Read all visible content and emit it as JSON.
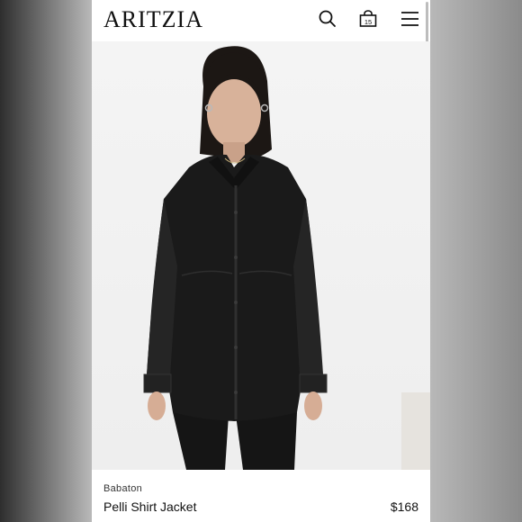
{
  "header": {
    "logo": "ARITZIA",
    "search_icon": "search-icon",
    "bag_icon": "shopping-bag-icon",
    "bag_count": "15",
    "menu_icon": "hamburger-menu-icon"
  },
  "product": {
    "image_alt": "Model wearing black faux-leather oversized shirt jacket",
    "brand": "Babaton",
    "name": "Pelli Shirt Jacket",
    "price": "$168"
  },
  "colors": {
    "jacket": "#1a1a1a",
    "background": "#f2f2f2",
    "text": "#111111"
  }
}
